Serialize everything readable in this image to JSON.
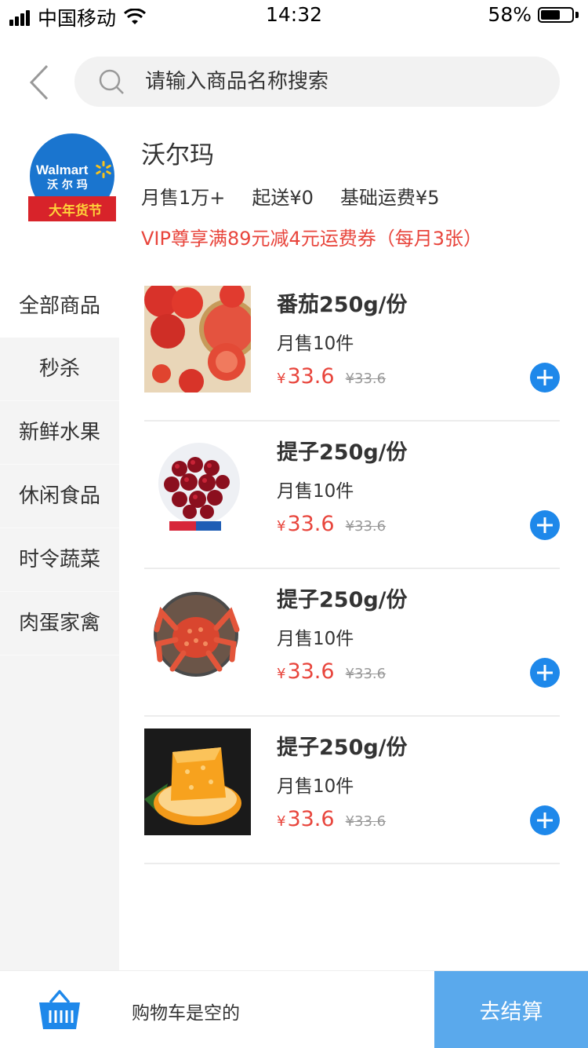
{
  "status_bar": {
    "carrier": "中国移动",
    "time": "14:32",
    "battery": "58%"
  },
  "search": {
    "placeholder": "请输入商品名称搜索"
  },
  "store": {
    "logo_text": "Walmart",
    "logo_cn": "沃 尔 玛",
    "logo_banner": "大年货节",
    "name": "沃尔玛",
    "monthly_sales": "月售1万+",
    "min_delivery": "起送¥0",
    "base_fee": "基础运费¥5",
    "vip_promo": "VIP尊享满89元减4元运费券（每月3张）"
  },
  "categories": [
    {
      "label": "全部商品",
      "active": true
    },
    {
      "label": "秒杀",
      "active": false
    },
    {
      "label": "新鲜水果",
      "active": false
    },
    {
      "label": "休闲食品",
      "active": false
    },
    {
      "label": "时令蔬菜",
      "active": false
    },
    {
      "label": "肉蛋家禽",
      "active": false
    }
  ],
  "products": [
    {
      "name": "番茄250g/份",
      "sold": "月售10件",
      "currency": "¥",
      "price": "33.6",
      "original_price": "¥33.6",
      "image": "tomato"
    },
    {
      "name": "提子250g/份",
      "sold": "月售10件",
      "currency": "¥",
      "price": "33.6",
      "original_price": "¥33.6",
      "image": "cherries"
    },
    {
      "name": "提子250g/份",
      "sold": "月售10件",
      "currency": "¥",
      "price": "33.6",
      "original_price": "¥33.6",
      "image": "king-crab"
    },
    {
      "name": "提子250g/份",
      "sold": "月售10件",
      "currency": "¥",
      "price": "33.6",
      "original_price": "¥33.6",
      "image": "orange"
    }
  ],
  "cart": {
    "status": "购物车是空的",
    "checkout_label": "去结算"
  },
  "colors": {
    "accent_blue": "#1e88ea",
    "checkout_blue": "#5aa9ec",
    "price_red": "#e8453c",
    "walmart_blue": "#1a75cf"
  }
}
